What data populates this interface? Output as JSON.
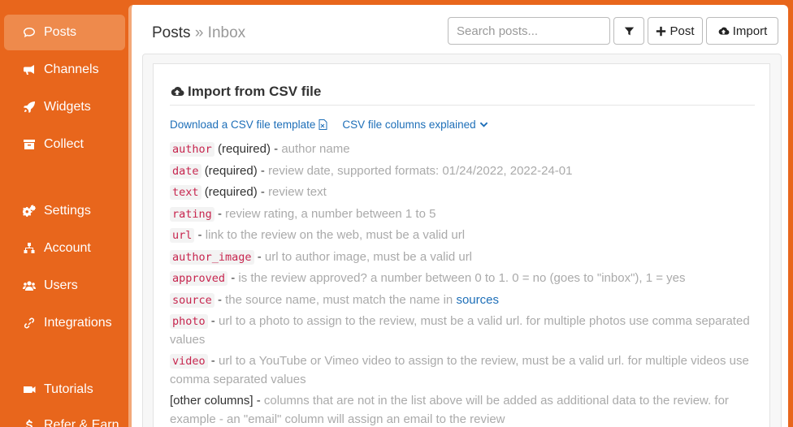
{
  "sidebar": {
    "items": [
      {
        "label": "Posts",
        "icon": "comment-icon",
        "active": true
      },
      {
        "label": "Channels",
        "icon": "megaphone-icon"
      },
      {
        "label": "Widgets",
        "icon": "rocket-icon"
      },
      {
        "label": "Collect",
        "icon": "archive-icon"
      },
      {
        "label": "Settings",
        "icon": "cogs-icon"
      },
      {
        "label": "Account",
        "icon": "sitemap-icon"
      },
      {
        "label": "Users",
        "icon": "users-icon"
      },
      {
        "label": "Integrations",
        "icon": "link-icon"
      },
      {
        "label": "Tutorials",
        "icon": "video-icon"
      },
      {
        "label": "Refer & Earn",
        "icon": "dollar-icon"
      }
    ]
  },
  "header": {
    "breadcrumb_root": "Posts",
    "breadcrumb_sep": "»",
    "breadcrumb_sub": "Inbox",
    "search_placeholder": "Search posts...",
    "post_label": "Post",
    "import_label": "Import"
  },
  "import": {
    "title": "Import from CSV file",
    "template_link": "Download a CSV file template",
    "columns_link": "CSV file columns explained",
    "columns": [
      {
        "code": "author",
        "req": "(required)",
        "sep": " - ",
        "desc": "author name"
      },
      {
        "code": "date",
        "req": "(required)",
        "sep": " - ",
        "desc": "review date, supported formats: 01/24/2022, 2022-24-01"
      },
      {
        "code": "text",
        "req": "(required)",
        "sep": " - ",
        "desc": "review text"
      },
      {
        "code": "rating",
        "req": "",
        "sep": " - ",
        "desc": "review rating, a number between 1 to 5"
      },
      {
        "code": "url",
        "req": "",
        "sep": " - ",
        "desc": "link to the review on the web, must be a valid url"
      },
      {
        "code": "author_image",
        "req": "",
        "sep": " - ",
        "desc": "url to author image, must be a valid url"
      },
      {
        "code": "approved",
        "req": "",
        "sep": " - ",
        "desc": "is the review approved? a number between 0 to 1. 0 = no (goes to \"inbox\"), 1 = yes"
      },
      {
        "code": "source",
        "req": "",
        "sep": " - ",
        "desc": "the source name, must match the name in",
        "link": "sources"
      },
      {
        "code": "photo",
        "req": "",
        "sep": " - ",
        "desc": "url to a photo to assign to the review, must be a valid url. for multiple photos use comma separated values"
      },
      {
        "code": "video",
        "req": "",
        "sep": " - ",
        "desc": "url to a YouTube or Vimeo video to assign to the review, must be a valid url. for multiple videos use comma separated values"
      }
    ],
    "other_label": "[other columns]",
    "other_sep": " - ",
    "other_desc": "columns that are not in the list above will be added as additional data to the review. for example - an \"email\" column will assign an email to the review"
  }
}
